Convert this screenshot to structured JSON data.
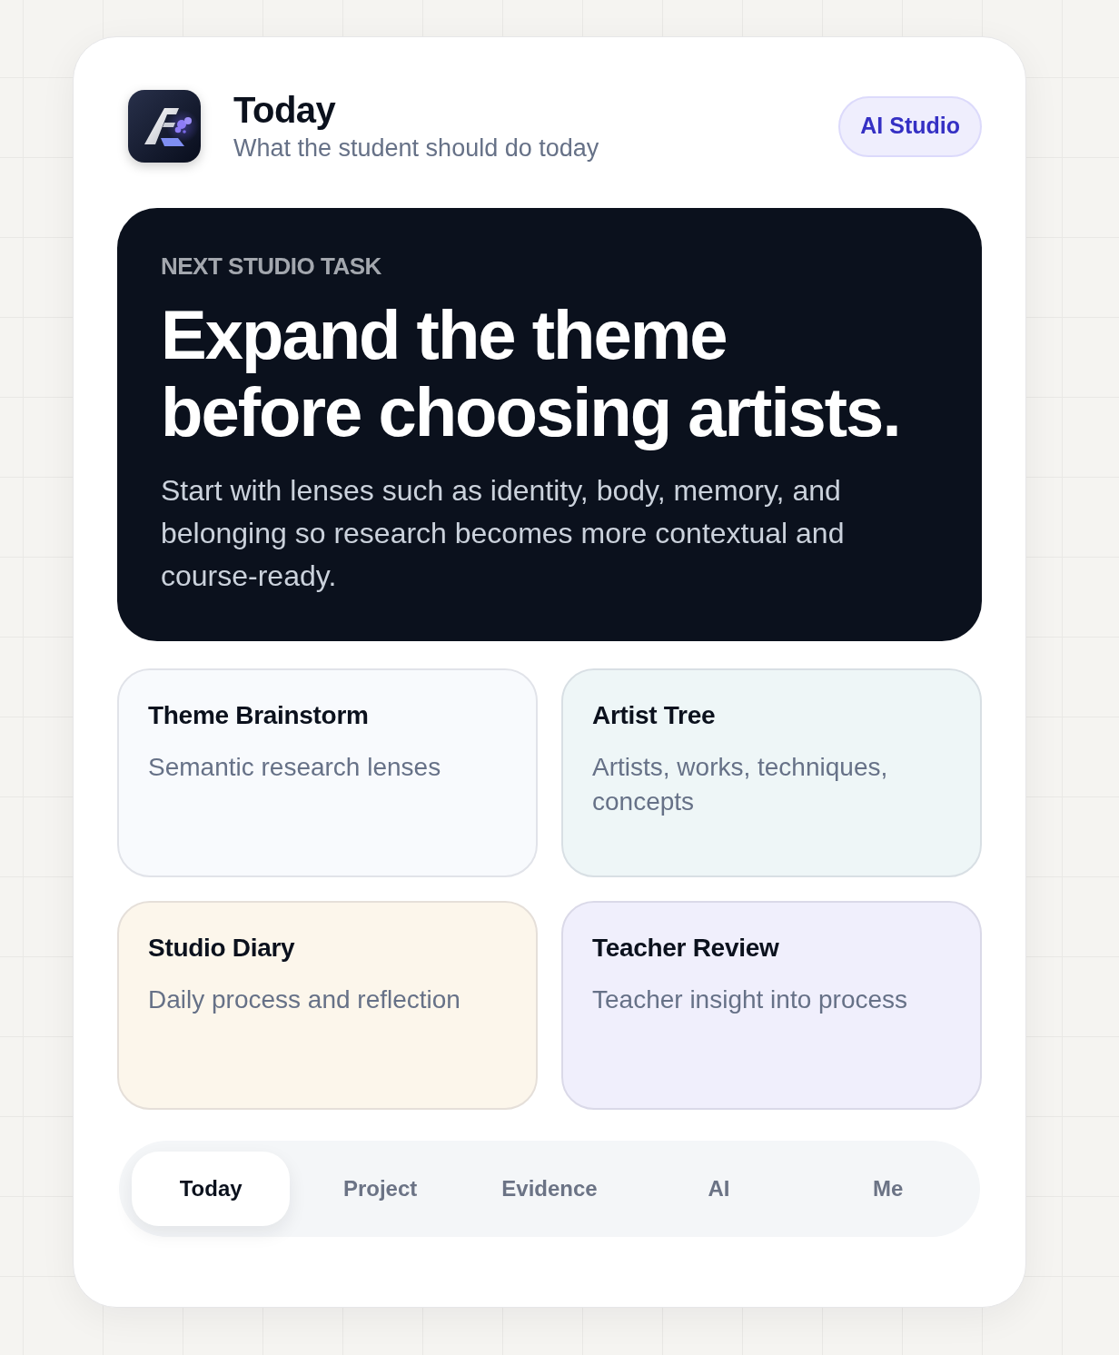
{
  "header": {
    "title": "Today",
    "subtitle": "What the student should do today",
    "badge": "AI Studio"
  },
  "hero": {
    "eyebrow": "NEXT STUDIO TASK",
    "headline": "Expand the theme before choosing artists.",
    "body": "Start with lenses such as identity, body, memory, and belonging so research becomes more contextual and course-ready."
  },
  "cards": [
    {
      "title": "Theme Brainstorm",
      "subtitle": "Semantic research lenses",
      "color": "#f8fafd"
    },
    {
      "title": "Artist Tree",
      "subtitle": "Artists, works, techniques, concepts",
      "color": "#eef6f7"
    },
    {
      "title": "Studio Diary",
      "subtitle": "Daily process and reflection",
      "color": "#fcf6eb"
    },
    {
      "title": "Teacher Review",
      "subtitle": "Teacher insight into process",
      "color": "#f0effc"
    }
  ],
  "tabs": [
    {
      "label": "Today",
      "selected": true
    },
    {
      "label": "Project",
      "selected": false
    },
    {
      "label": "Evidence",
      "selected": false
    },
    {
      "label": "AI",
      "selected": false
    },
    {
      "label": "Me",
      "selected": false
    }
  ]
}
